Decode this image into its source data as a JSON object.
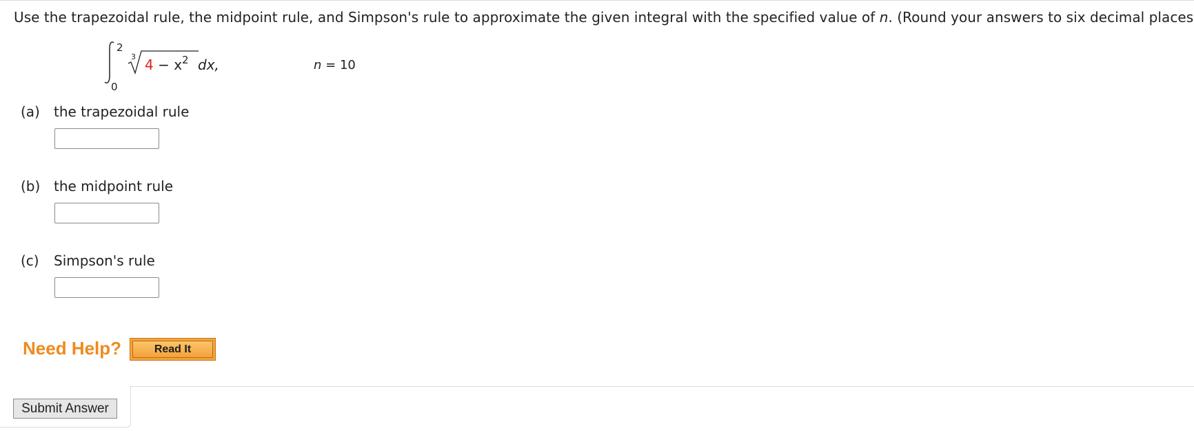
{
  "question": {
    "text_before_n": "Use the trapezoidal rule, the midpoint rule, and Simpson's rule to approximate the given integral with the specified value of ",
    "n_var": "n",
    "text_after_n": ". (Round your answers to six decimal places.)"
  },
  "integral": {
    "upper_limit": "2",
    "lower_limit": "0",
    "root_index": "3",
    "radicand_constant": "4",
    "radicand_rest": " − x",
    "exponent": "2",
    "differential": "dx,",
    "n_label": "n",
    "n_value": " = 10"
  },
  "parts": [
    {
      "letter": "(a)",
      "label": "the trapezoidal rule",
      "value": "",
      "placeholder": ""
    },
    {
      "letter": "(b)",
      "label": "the midpoint rule",
      "value": "",
      "placeholder": ""
    },
    {
      "letter": "(c)",
      "label": "Simpson's rule",
      "value": "",
      "placeholder": ""
    }
  ],
  "help": {
    "need_help_label": "Need Help?",
    "read_it_label": "Read It"
  },
  "submit": {
    "label": "Submit Answer"
  },
  "colors": {
    "need_help": "#f08a1c",
    "read_it_bg": "#f5a43b",
    "highlight_constant": "#e0201b"
  }
}
